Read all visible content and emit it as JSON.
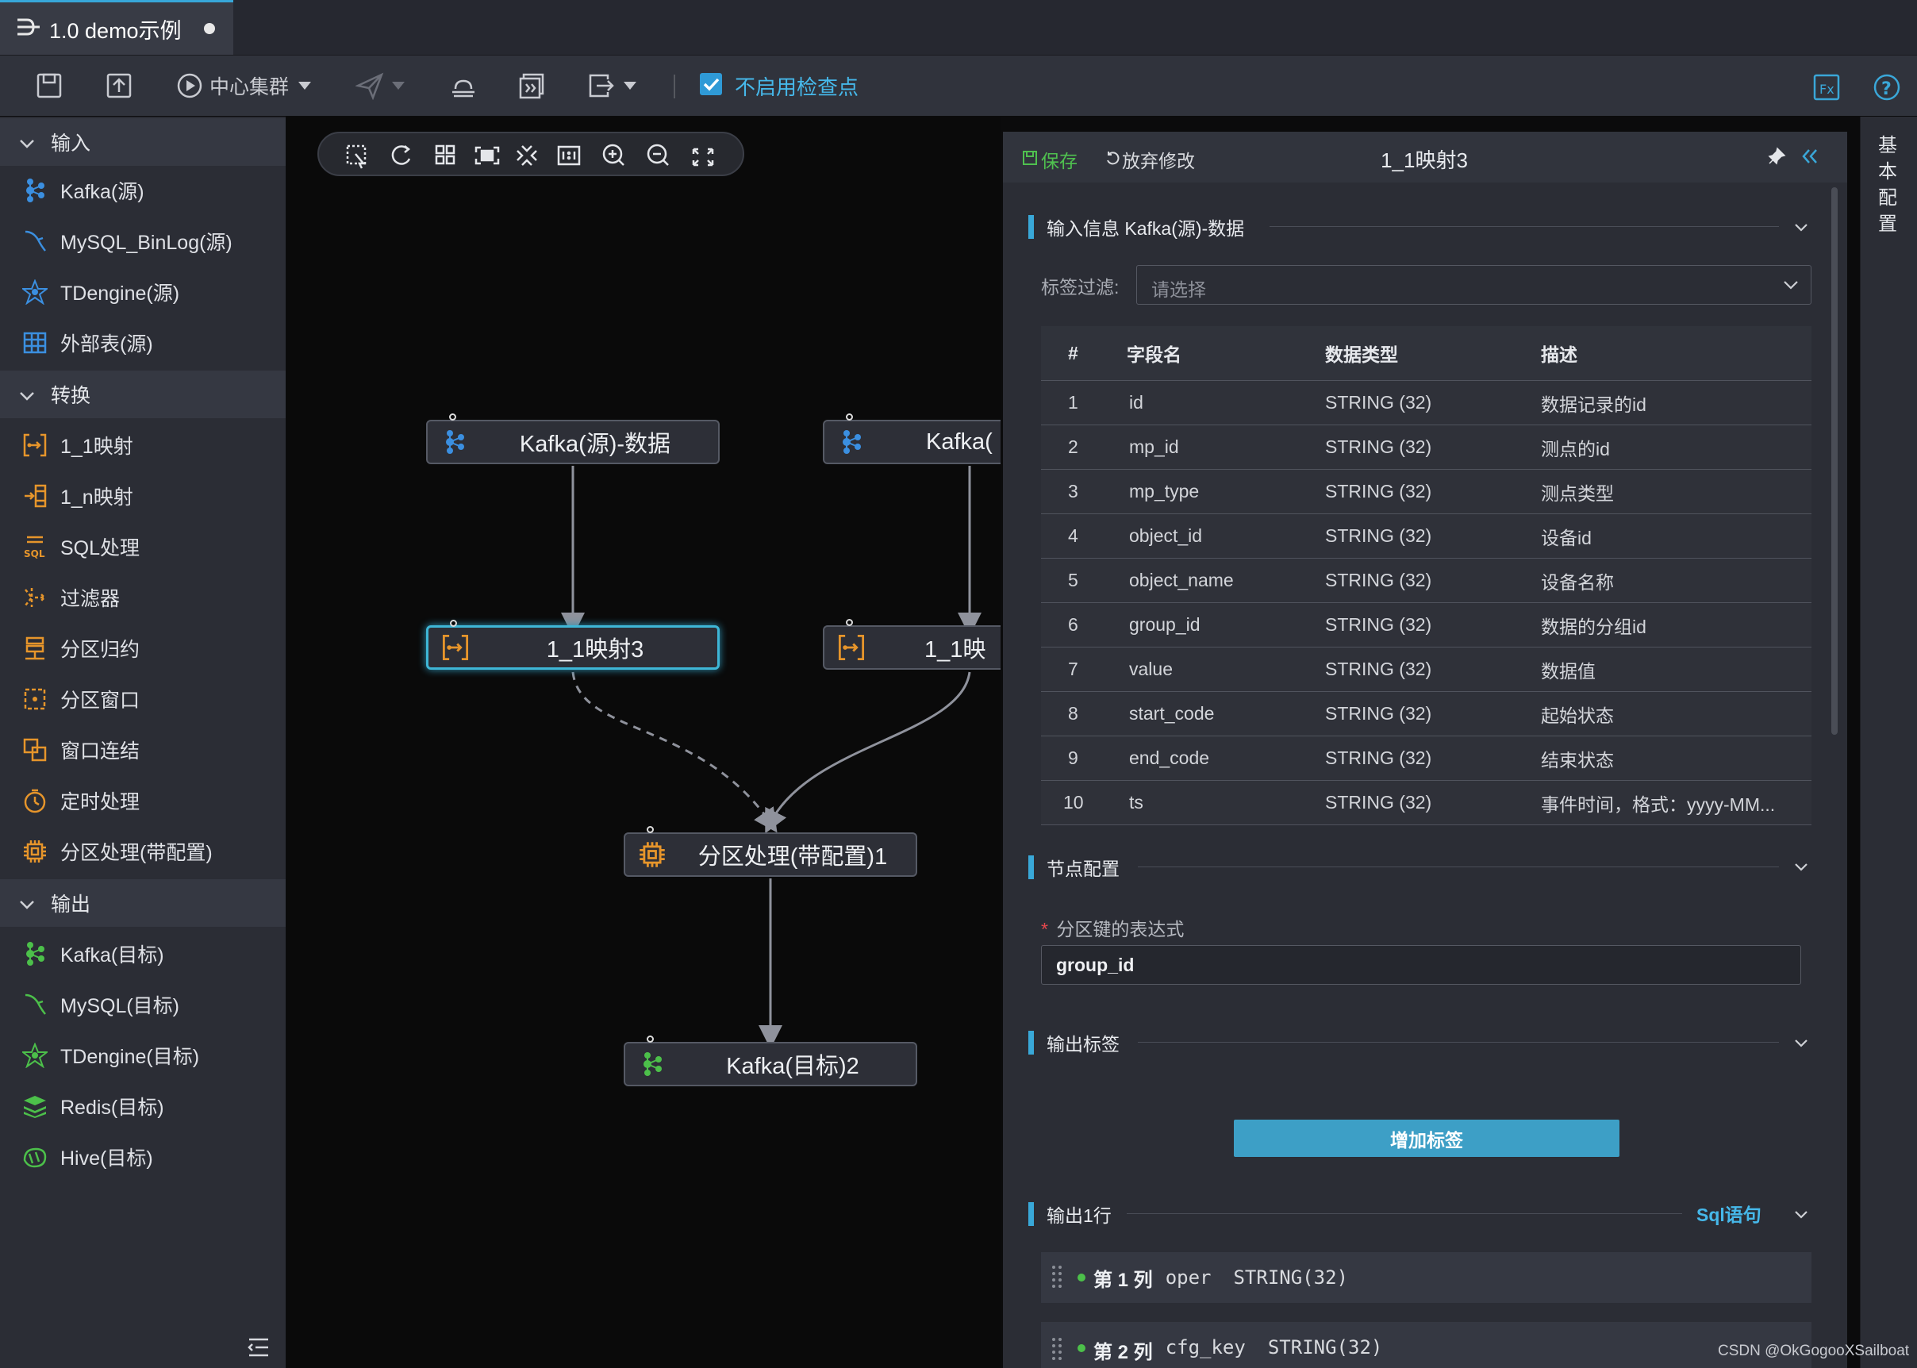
{
  "tab": {
    "title": "1.0 demo示例"
  },
  "toolbar": {
    "cluster_label": "中心集群",
    "checkpoint_label": "不启用检查点"
  },
  "sidebar": {
    "sections": [
      {
        "title": "输入",
        "items": [
          "Kafka(源)",
          "MySQL_BinLog(源)",
          "TDengine(源)",
          "外部表(源)"
        ]
      },
      {
        "title": "转换",
        "items": [
          "1_1映射",
          "1_n映射",
          "SQL处理",
          "过滤器",
          "分区归约",
          "分区窗口",
          "窗口连结",
          "定时处理",
          "分区处理(带配置)"
        ]
      },
      {
        "title": "输出",
        "items": [
          "Kafka(目标)",
          "MySQL(目标)",
          "TDengine(目标)",
          "Redis(目标)",
          "Hive(目标)"
        ]
      }
    ]
  },
  "canvas": {
    "nodes": {
      "kafka_src": "Kafka(源)-数据",
      "kafka_src2": "Kafka(",
      "map3": "1_1映射3",
      "map_other": "1_1映",
      "partition": "分区处理(带配置)1",
      "kafka_target": "Kafka(目标)2"
    }
  },
  "panel": {
    "save_label": "保存",
    "discard_label": "放弃修改",
    "title": "1_1映射3",
    "input_section": "输入信息 Kafka(源)-数据",
    "tag_filter_label": "标签过滤:",
    "tag_filter_placeholder": "请选择",
    "table": {
      "headers": [
        "#",
        "字段名",
        "数据类型",
        "描述"
      ],
      "rows": [
        [
          "1",
          "id",
          "STRING (32)",
          "数据记录的id"
        ],
        [
          "2",
          "mp_id",
          "STRING (32)",
          "测点的id"
        ],
        [
          "3",
          "mp_type",
          "STRING (32)",
          "测点类型"
        ],
        [
          "4",
          "object_id",
          "STRING (32)",
          "设备id"
        ],
        [
          "5",
          "object_name",
          "STRING (32)",
          "设备名称"
        ],
        [
          "6",
          "group_id",
          "STRING (32)",
          "数据的分组id"
        ],
        [
          "7",
          "value",
          "STRING (32)",
          "数据值"
        ],
        [
          "8",
          "start_code",
          "STRING (32)",
          "起始状态"
        ],
        [
          "9",
          "end_code",
          "STRING (32)",
          "结束状态"
        ],
        [
          "10",
          "ts",
          "STRING (32)",
          "事件时间，格式：yyyy-MM..."
        ]
      ]
    },
    "node_config_section": "节点配置",
    "partition_key_label": "分区键的表达式",
    "partition_key_value": "group_id",
    "output_tag_section": "输出标签",
    "add_tag_button": "增加标签",
    "output_row_section": "输出1行",
    "sql_link": "Sql语句",
    "output_columns": [
      {
        "label": "第 1 列",
        "name": "oper",
        "type": "STRING(32)"
      },
      {
        "label": "第 2 列",
        "name": "cfg_key",
        "type": "STRING(32)"
      }
    ]
  },
  "right_tab": {
    "label": "基本配置"
  },
  "watermark": "CSDN @OkGogooXSailboat",
  "colors": {
    "accent": "#37a7d9",
    "save_green": "#4fc04f",
    "node_blue": "#3b8fe0",
    "node_orange": "#e6952b",
    "node_green": "#4cc04a"
  }
}
